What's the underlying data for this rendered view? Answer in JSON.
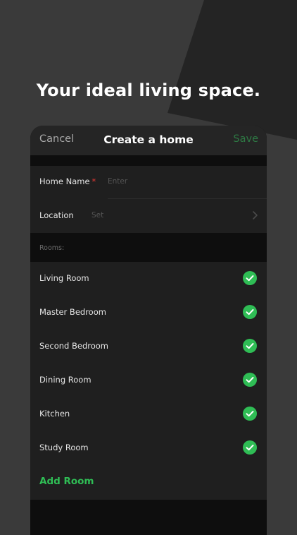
{
  "headline": "Your ideal living space.",
  "nav": {
    "cancel_label": "Cancel",
    "title": "Create a home",
    "save_label": "Save"
  },
  "form": {
    "home_name_label": "Home Name",
    "required_mark": "*",
    "home_name_placeholder": "Enter",
    "location_label": "Location",
    "location_placeholder": "Set"
  },
  "rooms_header": "Rooms:",
  "rooms": [
    {
      "name": "Living Room",
      "checked": true
    },
    {
      "name": "Master Bedroom",
      "checked": true
    },
    {
      "name": "Second Bedroom",
      "checked": true
    },
    {
      "name": "Dining Room",
      "checked": true
    },
    {
      "name": "Kitchen",
      "checked": true
    },
    {
      "name": "Study Room",
      "checked": true
    }
  ],
  "add_room_label": "Add Room",
  "colors": {
    "background": "#3a3a3a",
    "accent_green": "#2fbd55",
    "save_disabled": "#2e7a44",
    "required_red": "#e53935"
  }
}
